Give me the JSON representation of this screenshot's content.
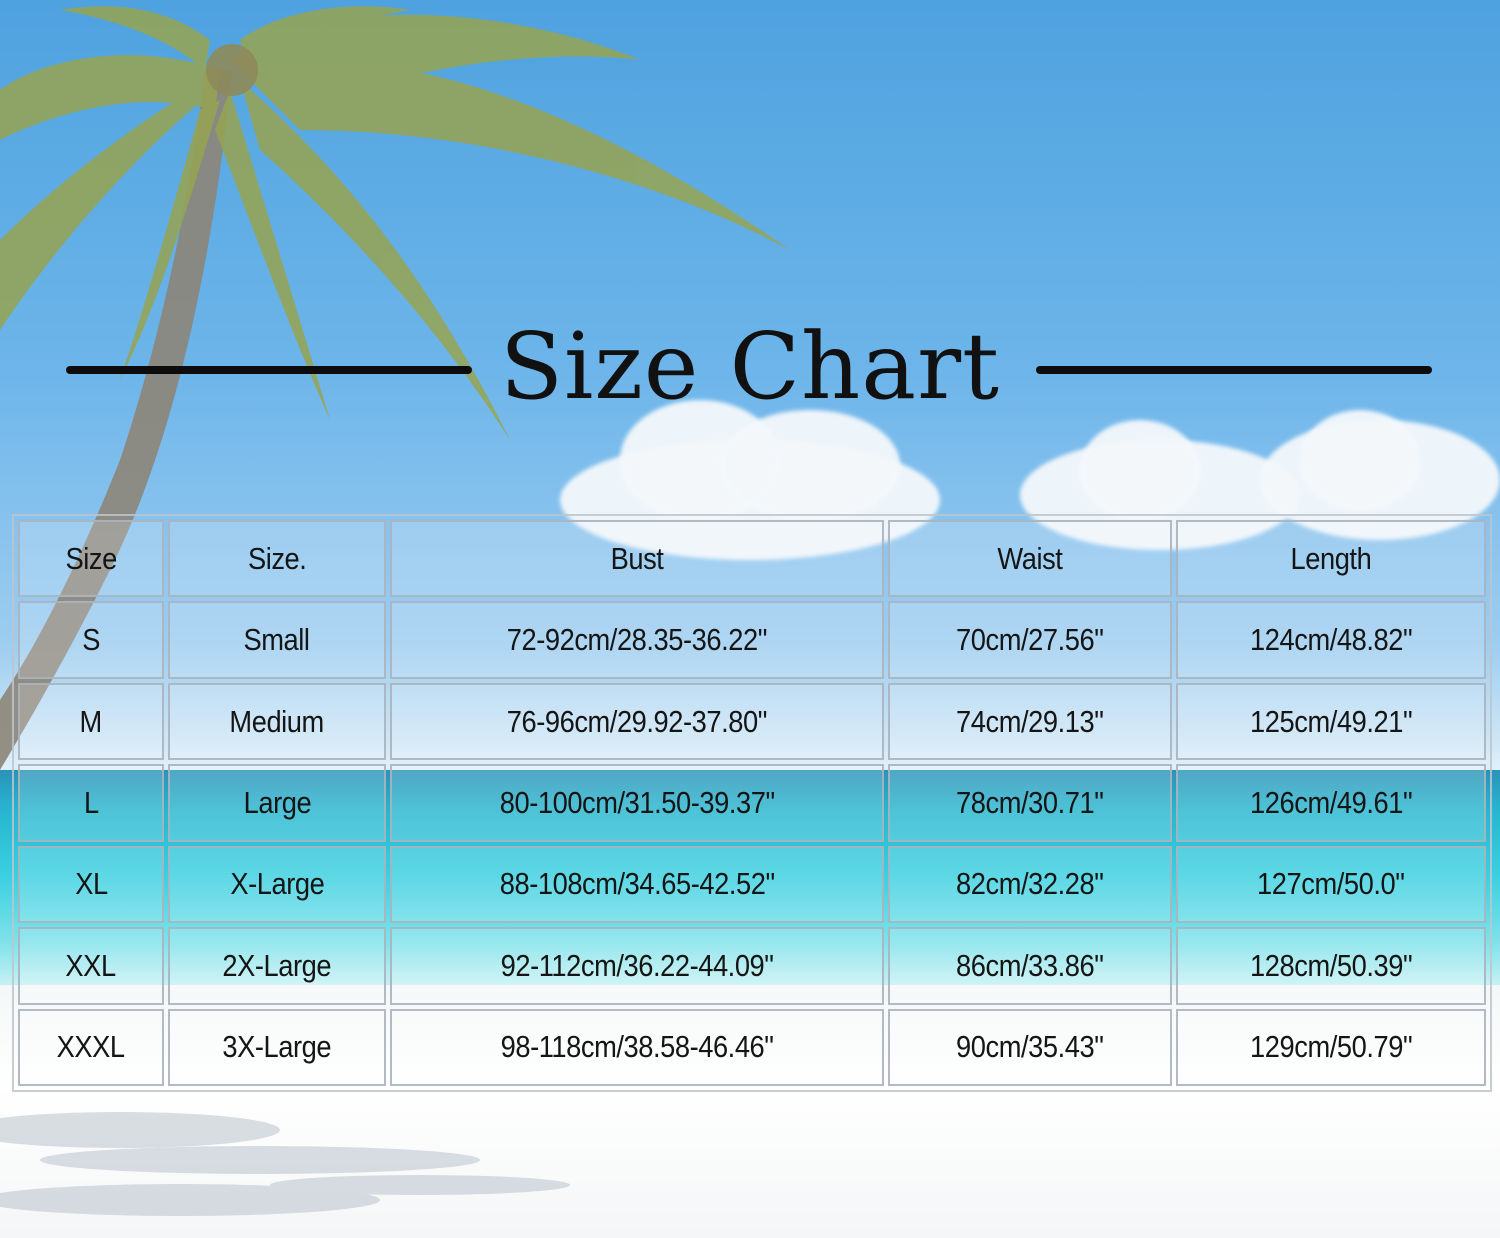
{
  "title": "Size Chart",
  "table": {
    "headers": [
      "Size",
      "Size.",
      "Bust",
      "Waist",
      "Length"
    ],
    "rows": [
      [
        "S",
        "Small",
        "72-92cm/28.35-36.22\"",
        "70cm/27.56\"",
        "124cm/48.82\""
      ],
      [
        "M",
        "Medium",
        "76-96cm/29.92-37.80\"",
        "74cm/29.13\"",
        "125cm/49.21\""
      ],
      [
        "L",
        "Large",
        "80-100cm/31.50-39.37\"",
        "78cm/30.71\"",
        "126cm/49.61\""
      ],
      [
        "XL",
        "X-Large",
        "88-108cm/34.65-42.52\"",
        "82cm/32.28\"",
        "127cm/50.0\""
      ],
      [
        "XXL",
        "2X-Large",
        "92-112cm/36.22-44.09\"",
        "86cm/33.86\"",
        "128cm/50.39\""
      ],
      [
        "XXXL",
        "3X-Large",
        "98-118cm/38.58-46.46\"",
        "90cm/35.43\"",
        "129cm/50.79\""
      ]
    ]
  },
  "colors": {
    "text": "#151515",
    "sky": "#4ea2df",
    "sea": "#38cfe0",
    "sand": "#ffffff",
    "palm_leaf": "#8fa24a"
  }
}
